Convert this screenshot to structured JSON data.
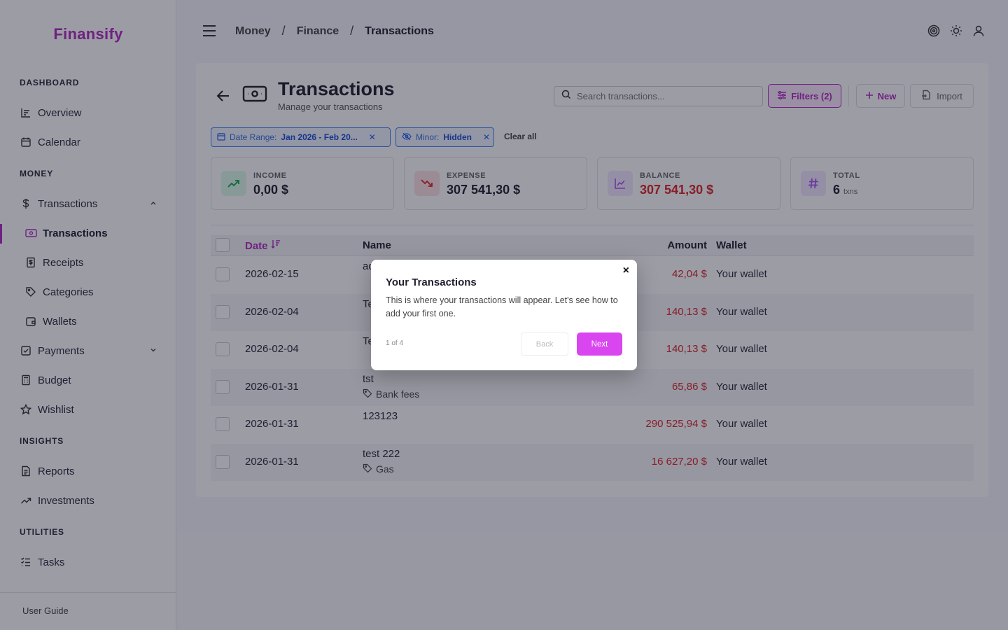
{
  "app": {
    "brand": "Finansify"
  },
  "sidebar": {
    "sections": {
      "dashboard": "DASHBOARD",
      "money": "MONEY",
      "insights": "INSIGHTS",
      "utilities": "UTILITIES"
    },
    "items": {
      "overview": "Overview",
      "calendar": "Calendar",
      "transactions": "Transactions",
      "transactions_sub": "Transactions",
      "receipts": "Receipts",
      "categories": "Categories",
      "wallets": "Wallets",
      "payments": "Payments",
      "budget": "Budget",
      "wishlist": "Wishlist",
      "reports": "Reports",
      "investments": "Investments",
      "tasks": "Tasks"
    },
    "footer": "User Guide"
  },
  "header": {
    "breadcrumbs": [
      "Money",
      "Finance",
      "Transactions"
    ]
  },
  "page": {
    "title": "Transactions",
    "subtitle": "Manage your transactions",
    "search_placeholder": "Search transactions...",
    "filters_label": "Filters (2)",
    "new_label": "New",
    "import_label": "Import",
    "chips": [
      {
        "label": "Date Range:",
        "value": "Jan 2026 - Feb 20..."
      },
      {
        "label": "Minor:",
        "value": "Hidden"
      }
    ],
    "clear_all": "Clear all"
  },
  "stats": [
    {
      "label": "INCOME",
      "value": "0,00 $",
      "color": "#16a34a"
    },
    {
      "label": "EXPENSE",
      "value": "307 541,30 $",
      "color": "#dc2626"
    },
    {
      "label": "BALANCE",
      "value": "307 541,30 $",
      "color": "#a855f7"
    },
    {
      "label": "TOTAL",
      "value": "6",
      "unit": "txns",
      "color": "#a855f7"
    }
  ],
  "table": {
    "headers": {
      "date": "Date",
      "name": "Name",
      "amount": "Amount",
      "wallet": "Wallet"
    },
    "rows": [
      {
        "date": "2026-02-15",
        "name": "ad",
        "tag": "",
        "amount": "42,04 $",
        "wallet": "Your wallet"
      },
      {
        "date": "2026-02-04",
        "name": "Te",
        "tag": "",
        "amount": "140,13 $",
        "wallet": "Your wallet"
      },
      {
        "date": "2026-02-04",
        "name": "Te",
        "tag": "",
        "amount": "140,13 $",
        "wallet": "Your wallet"
      },
      {
        "date": "2026-01-31",
        "name": "tst",
        "tag": "Bank fees",
        "amount": "65,86 $",
        "wallet": "Your wallet"
      },
      {
        "date": "2026-01-31",
        "name": "123123",
        "tag": "",
        "amount": "290 525,94 $",
        "wallet": "Your wallet"
      },
      {
        "date": "2026-01-31",
        "name": "test 222",
        "tag": "Gas",
        "amount": "16 627,20 $",
        "wallet": "Your wallet"
      }
    ]
  },
  "tour": {
    "title": "Your Transactions",
    "body": "This is where your transactions will appear. Let's see how to add your first one.",
    "step": "1 of 4",
    "back": "Back",
    "next": "Next",
    "close": "×"
  },
  "colors": {
    "accent": "#b12cc0",
    "expense": "#dc2626",
    "chip": "#2563eb",
    "next_button": "#d946ef"
  }
}
